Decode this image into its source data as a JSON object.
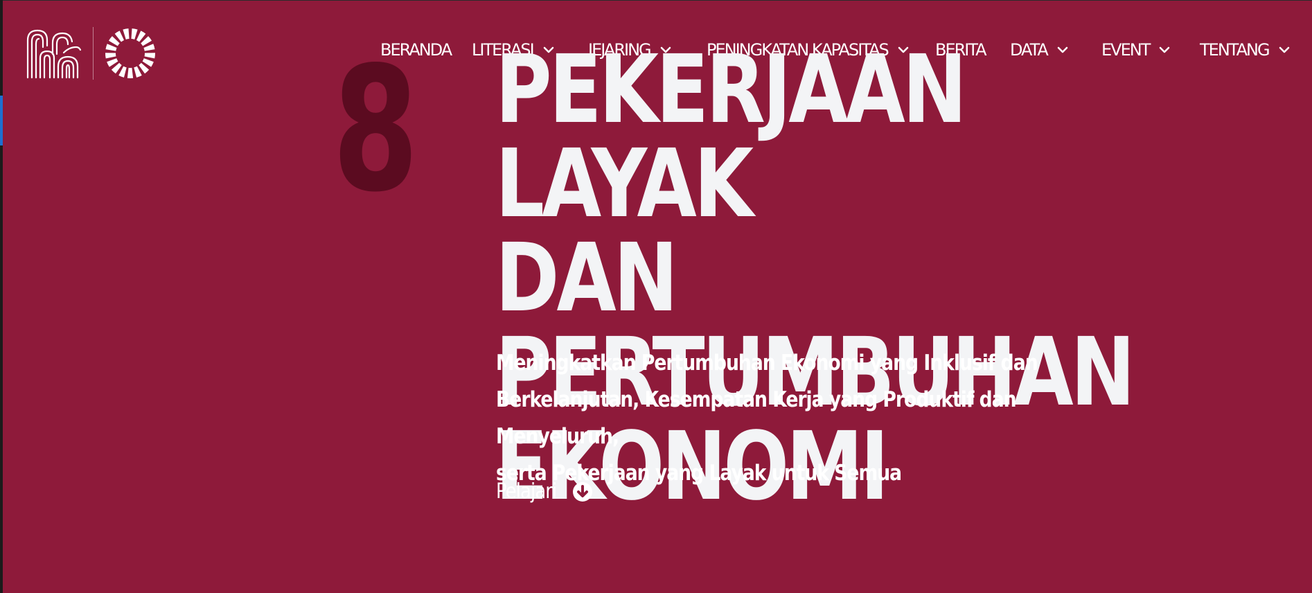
{
  "colors": {
    "background": "#8e1a3a",
    "number": "#5b0b20",
    "title": "#f3f4f6",
    "text": "#ffffff"
  },
  "header": {
    "brand_logo_icon": "brand-logo-icon",
    "sdg_logo_icon": "sdg-wheel-icon",
    "nav": [
      {
        "label": "BERANDA",
        "has_dropdown": false
      },
      {
        "label": "LITERASI",
        "has_dropdown": true
      },
      {
        "label": "JEJARING",
        "has_dropdown": true
      },
      {
        "label": "PENINGKATAN KAPASITAS",
        "has_dropdown": true
      },
      {
        "label": "BERITA",
        "has_dropdown": false
      },
      {
        "label": "DATA",
        "has_dropdown": true
      },
      {
        "label": "EVENT",
        "has_dropdown": true
      },
      {
        "label": "TENTANG",
        "has_dropdown": true
      }
    ]
  },
  "hero": {
    "goal_number": "8",
    "title_lines": [
      "PEKERJAAN LAYAK",
      "DAN PERTUMBUHAN",
      "EKONOMI"
    ],
    "subtitle_lines": [
      "Meningkatkan Pertumbuhan Ekonomi yang Inklusif dan",
      "Berkelanjutan, Kesempatan Kerja yang Produktif dan Menyeluruh,",
      "serta Pekerjaan yang Layak untuk Semua"
    ],
    "learn_more_label": "Pelajari",
    "learn_more_icon": "arrow-down-circle-icon"
  }
}
